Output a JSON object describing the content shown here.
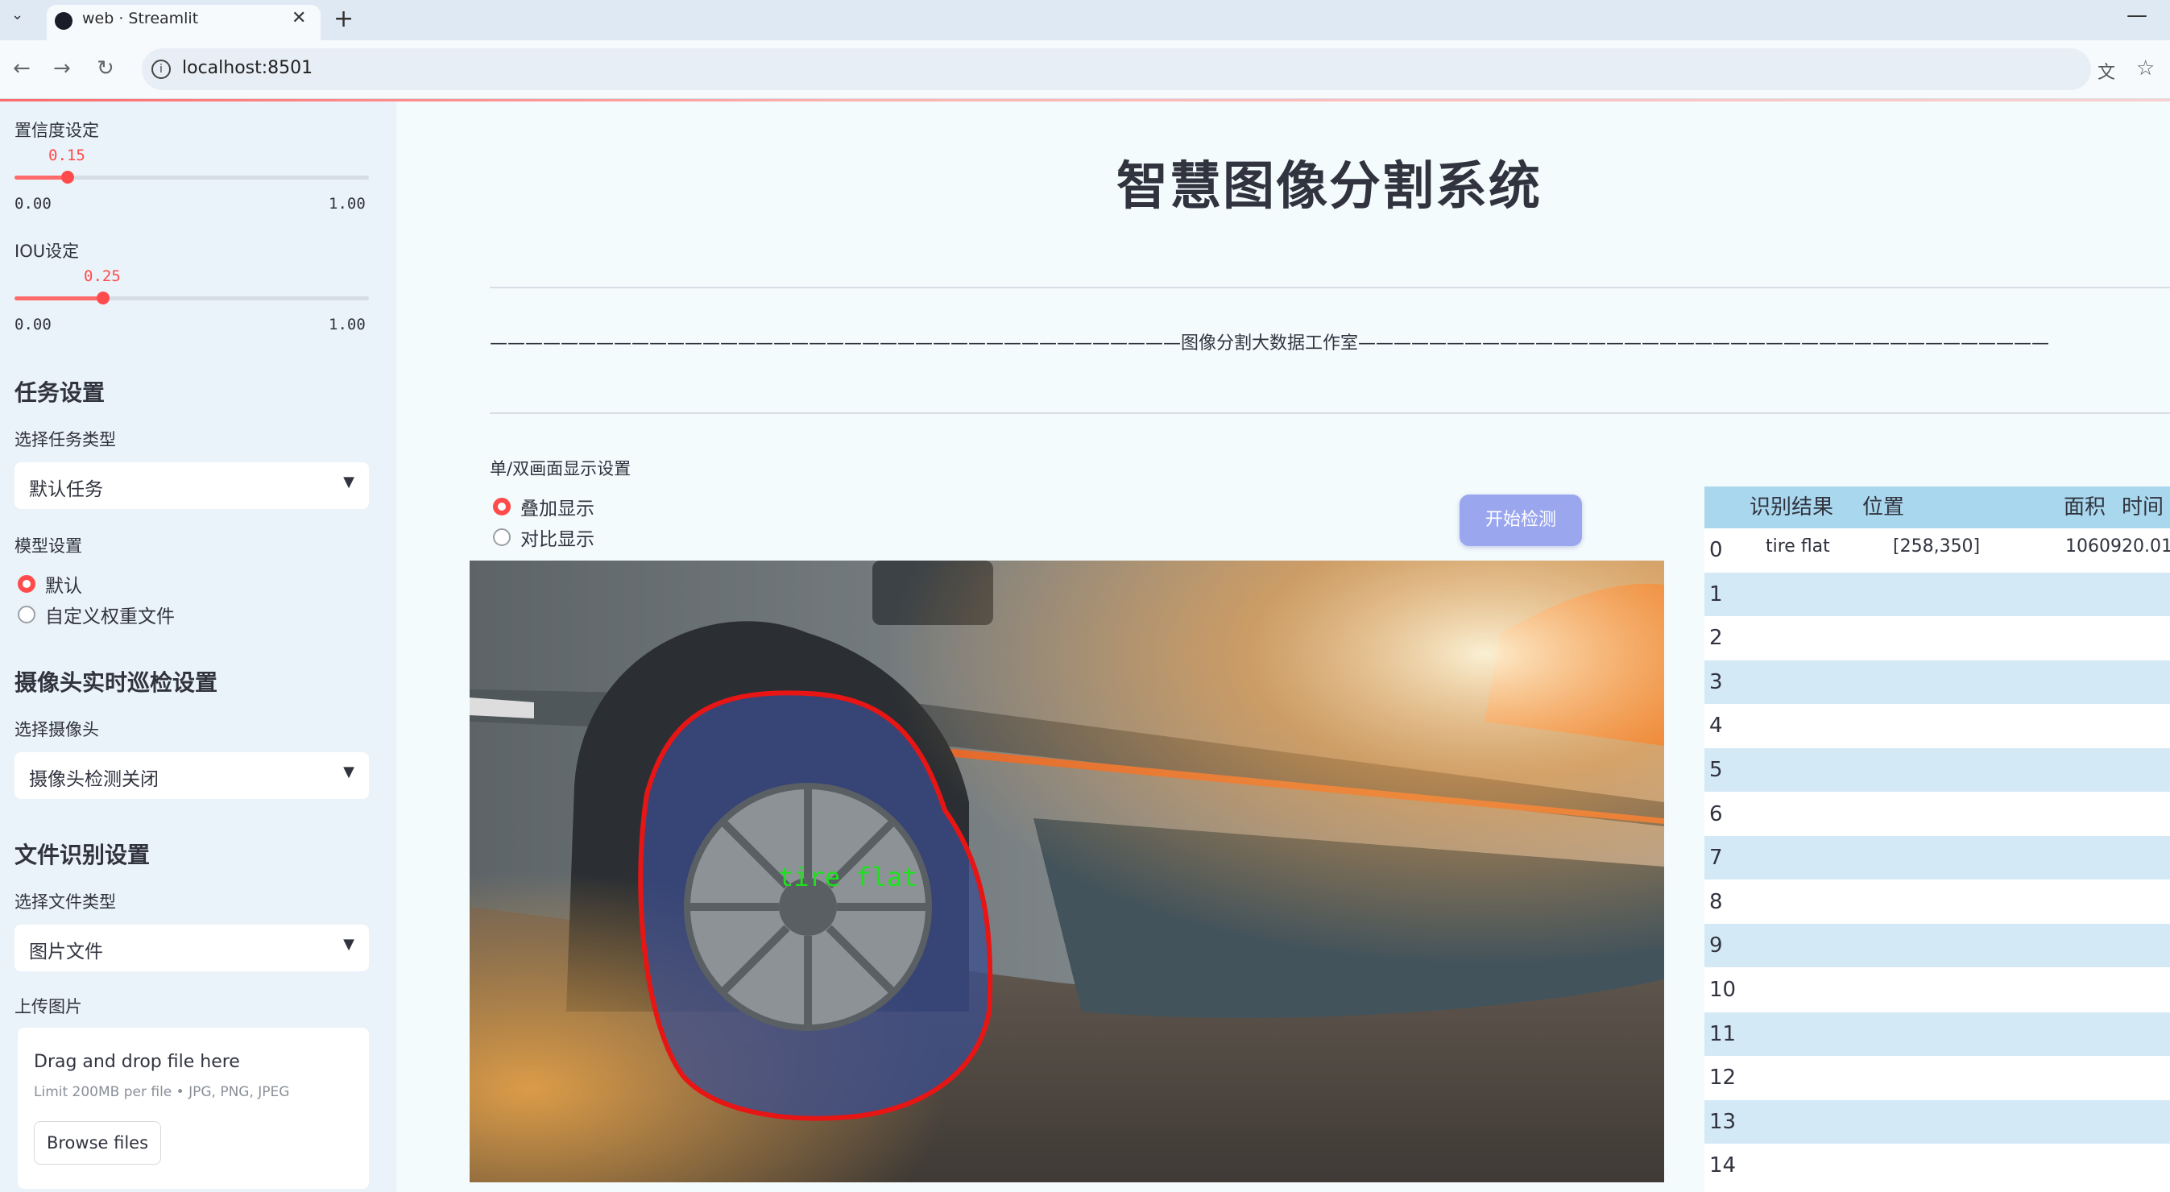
{
  "browser": {
    "tab_title": "web · Streamlit",
    "url": "localhost:8501"
  },
  "sidebar": {
    "confidence": {
      "label": "置信度设定",
      "value": "0.15",
      "min": "0.00",
      "max": "1.00",
      "fraction": 0.15
    },
    "iou": {
      "label": "IOU设定",
      "value": "0.25",
      "min": "0.00",
      "max": "1.00",
      "fraction": 0.25
    },
    "task": {
      "heading": "任务设置",
      "label": "选择任务类型",
      "selected": "默认任务"
    },
    "model": {
      "label": "模型设置",
      "options": [
        "默认",
        "自定义权重文件"
      ],
      "selected_index": 0
    },
    "camera": {
      "heading": "摄像头实时巡检设置",
      "label": "选择摄像头",
      "selected": "摄像头检测关闭"
    },
    "file": {
      "heading": "文件识别设置",
      "label": "选择文件类型",
      "selected": "图片文件"
    },
    "upload": {
      "label": "上传图片",
      "drop_text": "Drag and drop file here",
      "limit_text": "Limit 200MB per file • JPG, PNG, JPEG",
      "browse_label": "Browse files"
    }
  },
  "main": {
    "title": "智慧图像分割系统",
    "studio_line": "———————————————————————————————————————图像分割大数据工作室———————————————————————————————————————",
    "display": {
      "label": "单/双画面显示设置",
      "options": [
        "叠加显示",
        "对比显示"
      ],
      "selected_index": 0
    },
    "start_button": "开始检测",
    "detection_label": "tire flat"
  },
  "results_table": {
    "columns": [
      "识别结果",
      "位置",
      "面积",
      "时间"
    ],
    "rows": [
      {
        "index": "0",
        "result": "tire flat",
        "position": "[258,350]",
        "area": "1060920.01"
      },
      {
        "index": "1"
      },
      {
        "index": "2"
      },
      {
        "index": "3"
      },
      {
        "index": "4"
      },
      {
        "index": "5"
      },
      {
        "index": "6"
      },
      {
        "index": "7"
      },
      {
        "index": "8"
      },
      {
        "index": "9"
      },
      {
        "index": "10"
      },
      {
        "index": "11"
      },
      {
        "index": "12"
      },
      {
        "index": "13"
      },
      {
        "index": "14"
      }
    ]
  },
  "colors": {
    "accent": "#ff4b4b",
    "button": "#9aa6ee",
    "table_header": "#a9d8ee",
    "table_alt_row": "#d4e9f6"
  }
}
